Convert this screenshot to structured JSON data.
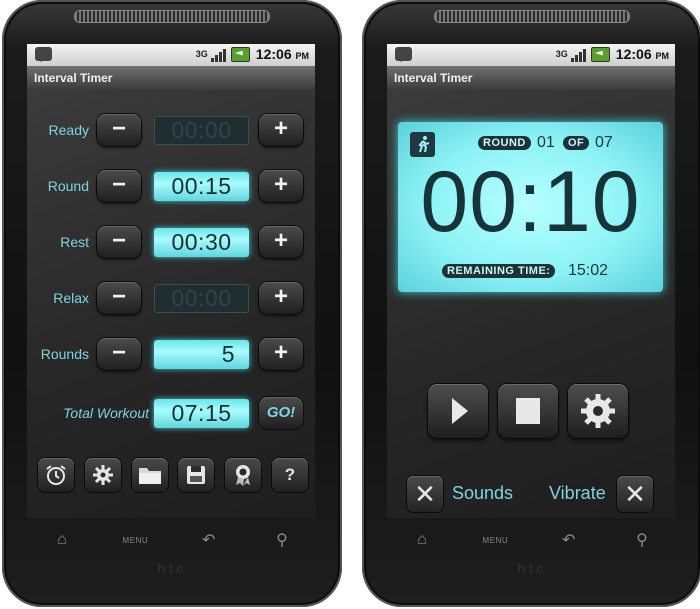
{
  "status": {
    "network": "3G",
    "time": "12:06",
    "ampm": "PM"
  },
  "app": {
    "title": "Interval Timer"
  },
  "setup": {
    "rows": [
      {
        "label": "Ready",
        "value": "00:00",
        "active": false
      },
      {
        "label": "Round",
        "value": "00:15",
        "active": true
      },
      {
        "label": "Rest",
        "value": "00:30",
        "active": true
      },
      {
        "label": "Relax",
        "value": "00:00",
        "active": false
      },
      {
        "label": "Rounds",
        "value": "5",
        "active": true
      }
    ],
    "minus_label": "−",
    "plus_label": "+",
    "total_label": "Total Workout",
    "total_value": "07:15",
    "go_label": "GO!",
    "toolbar_icons": [
      "alarm-clock-icon",
      "gear-icon",
      "folder-icon",
      "save-icon",
      "award-icon",
      "help-icon"
    ],
    "help_glyph": "?"
  },
  "timer": {
    "round_tag": "ROUND",
    "round_current": "01",
    "of_tag": "OF",
    "round_total": "07",
    "time": "00:10",
    "remaining_tag": "REMAINING TIME:",
    "remaining_value": "15:02",
    "sounds_label": "Sounds",
    "vibrate_label": "Vibrate",
    "sounds_on": false,
    "vibrate_on": false
  },
  "device": {
    "menu_label": "MENU",
    "brand": "htc"
  },
  "colors": {
    "accent": "#7fd4e2",
    "lcd": "#8df3f6",
    "lcd_text": "#173438"
  }
}
